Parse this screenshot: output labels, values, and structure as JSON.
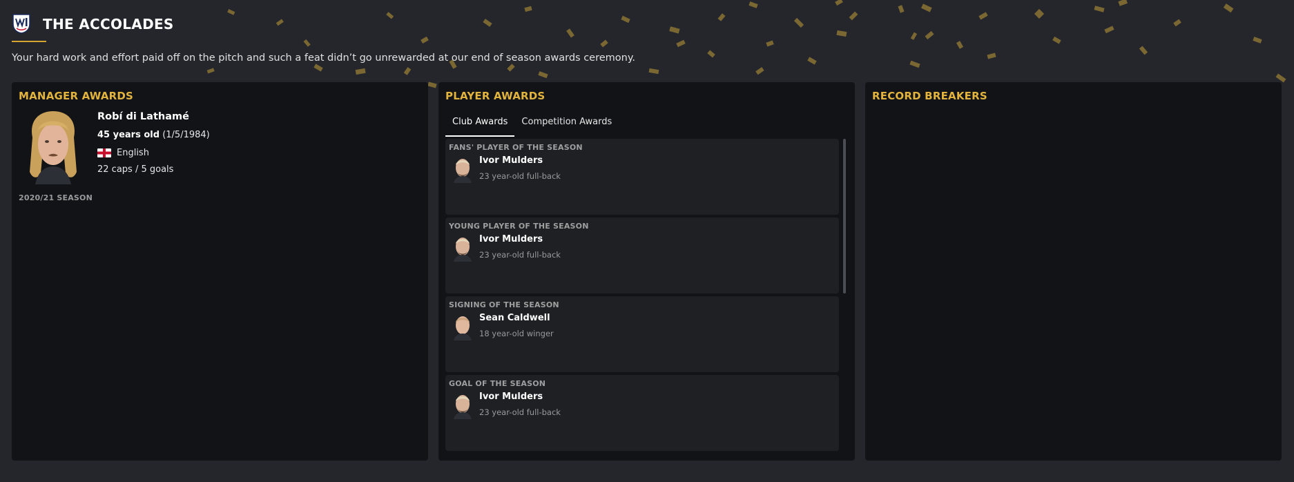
{
  "header": {
    "club_badge_icon": "club-crest-icon",
    "title": "THE ACCOLADES",
    "intro": "Your hard work and effort paid off on the pitch and such a feat didn’t go unrewarded at our end of season awards ceremony."
  },
  "colors": {
    "accent": "#e2b43e",
    "panel_bg": "#111316",
    "page_bg": "#24262c",
    "card_bg": "#1e2024"
  },
  "manager_awards": {
    "title": "MANAGER AWARDS",
    "name": "Robí di Lathamé",
    "age": "45 years old",
    "dob": "(1/5/1984)",
    "nationality": "English",
    "flag_icon": "england-flag-icon",
    "caps": "22 caps / 5 goals",
    "season": "2020/21 SEASON"
  },
  "player_awards": {
    "title": "PLAYER AWARDS",
    "tabs": [
      {
        "label": "Club Awards",
        "active": true
      },
      {
        "label": "Competition Awards",
        "active": false
      }
    ],
    "awards": [
      {
        "title": "FANS' PLAYER OF THE SEASON",
        "name": "Ivor Mulders",
        "desc": "23 year-old full-back"
      },
      {
        "title": "YOUNG PLAYER OF THE SEASON",
        "name": "Ivor Mulders",
        "desc": "23 year-old full-back"
      },
      {
        "title": "SIGNING OF THE SEASON",
        "name": "Sean Caldwell",
        "desc": "18 year-old winger"
      },
      {
        "title": "GOAL OF THE SEASON",
        "name": "Ivor Mulders",
        "desc": "23 year-old full-back"
      }
    ]
  },
  "record_breakers": {
    "title": "RECORD BREAKERS"
  }
}
